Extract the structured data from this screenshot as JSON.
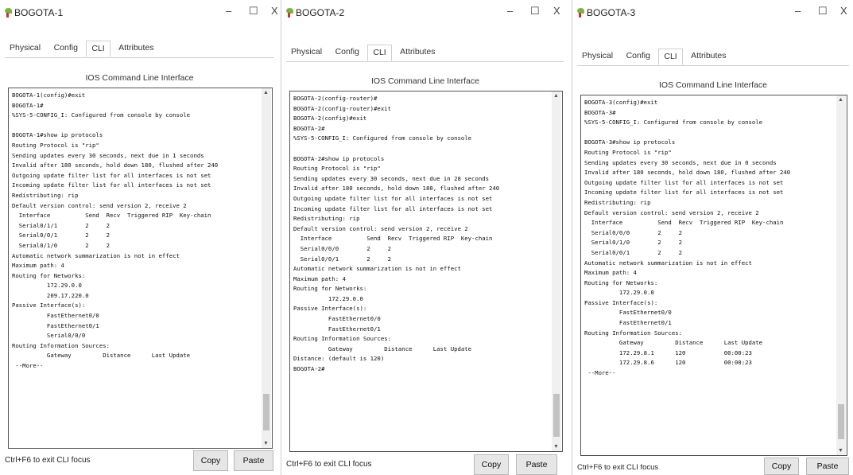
{
  "windows": [
    {
      "title": "BOGOTA-1",
      "tabs": [
        "Physical",
        "Config",
        "CLI",
        "Attributes"
      ],
      "active_tab": "CLI",
      "ios_title": "IOS Command Line Interface",
      "console_lines": [
        "BOGOTA-1(config)#exit",
        "BOGOTA-1#",
        "%SYS-5-CONFIG_I: Configured from console by console",
        "",
        "BOGOTA-1#show ip protocols",
        "Routing Protocol is \"rip\"",
        "Sending updates every 30 seconds, next due in 1 seconds",
        "Invalid after 180 seconds, hold down 180, flushed after 240",
        "Outgoing update filter list for all interfaces is not set",
        "Incoming update filter list for all interfaces is not set",
        "Redistributing: rip",
        "Default version control: send version 2, receive 2",
        "  Interface          Send  Recv  Triggered RIP  Key-chain",
        "  Serial0/1/1        2     2",
        "  Serial0/0/1        2     2",
        "  Serial0/1/0        2     2",
        "Automatic network summarization is not in effect",
        "Maximum path: 4",
        "Routing for Networks:",
        "          172.29.0.0",
        "          209.17.220.0",
        "Passive Interface(s):",
        "          FastEthernet0/0",
        "          FastEthernet0/1",
        "          Serial0/0/0",
        "Routing Information Sources:",
        "          Gateway         Distance      Last Update",
        " --More--"
      ],
      "footer_text": "Ctrl+F6 to exit CLI focus",
      "copy_label": "Copy",
      "paste_label": "Paste"
    },
    {
      "title": "BOGOTA-2",
      "tabs": [
        "Physical",
        "Config",
        "CLI",
        "Attributes"
      ],
      "active_tab": "CLI",
      "ios_title": "IOS Command Line Interface",
      "console_lines": [
        "BOGOTA-2(config-router)#",
        "BOGOTA-2(config-router)#exit",
        "BOGOTA-2(config)#exit",
        "BOGOTA-2#",
        "%SYS-5-CONFIG_I: Configured from console by console",
        "",
        "BOGOTA-2#show ip protocols",
        "Routing Protocol is \"rip\"",
        "Sending updates every 30 seconds, next due in 28 seconds",
        "Invalid after 180 seconds, hold down 180, flushed after 240",
        "Outgoing update filter list for all interfaces is not set",
        "Incoming update filter list for all interfaces is not set",
        "Redistributing: rip",
        "Default version control: send version 2, receive 2",
        "  Interface          Send  Recv  Triggered RIP  Key-chain",
        "  Serial0/0/0        2     2",
        "  Serial0/0/1        2     2",
        "Automatic network summarization is not in effect",
        "Maximum path: 4",
        "Routing for Networks:",
        "          172.29.0.0",
        "Passive Interface(s):",
        "          FastEthernet0/0",
        "          FastEthernet0/1",
        "Routing Information Sources:",
        "          Gateway         Distance      Last Update",
        "Distance: (default is 120)",
        "BOGOTA-2#"
      ],
      "footer_text": "Ctrl+F6 to exit CLI focus",
      "copy_label": "Copy",
      "paste_label": "Paste"
    },
    {
      "title": "BOGOTA-3",
      "tabs": [
        "Physical",
        "Config",
        "CLI",
        "Attributes"
      ],
      "active_tab": "CLI",
      "ios_title": "IOS Command Line Interface",
      "console_lines": [
        "BOGOTA-3(config)#exit",
        "BOGOTA-3#",
        "%SYS-5-CONFIG_I: Configured from console by console",
        "",
        "BOGOTA-3#show ip protocols",
        "Routing Protocol is \"rip\"",
        "Sending updates every 30 seconds, next due in 0 seconds",
        "Invalid after 180 seconds, hold down 180, flushed after 240",
        "Outgoing update filter list for all interfaces is not set",
        "Incoming update filter list for all interfaces is not set",
        "Redistributing: rip",
        "Default version control: send version 2, receive 2",
        "  Interface          Send  Recv  Triggered RIP  Key-chain",
        "  Serial0/0/0        2     2",
        "  Serial0/1/0        2     2",
        "  Serial0/0/1        2     2",
        "Automatic network summarization is not in effect",
        "Maximum path: 4",
        "Routing for Networks:",
        "          172.29.0.0",
        "Passive Interface(s):",
        "          FastEthernet0/0",
        "          FastEthernet0/1",
        "Routing Information Sources:",
        "          Gateway         Distance      Last Update",
        "          172.29.8.1      120           00:00:23",
        "          172.29.8.6      120           00:00:23",
        " --More--"
      ],
      "footer_text": "Ctrl+F6 to exit CLI focus",
      "copy_label": "Copy",
      "paste_label": "Paste"
    }
  ],
  "window_controls": {
    "minimize": "–",
    "maximize": "☐",
    "close": "X"
  },
  "icons": {
    "app": "packet-tracer-leaf-icon"
  },
  "colors": {
    "console_border": "#555555",
    "button_bg": "#e6e6e6",
    "icon_leaf": "#7cb342",
    "icon_stem": "#c0392b"
  }
}
